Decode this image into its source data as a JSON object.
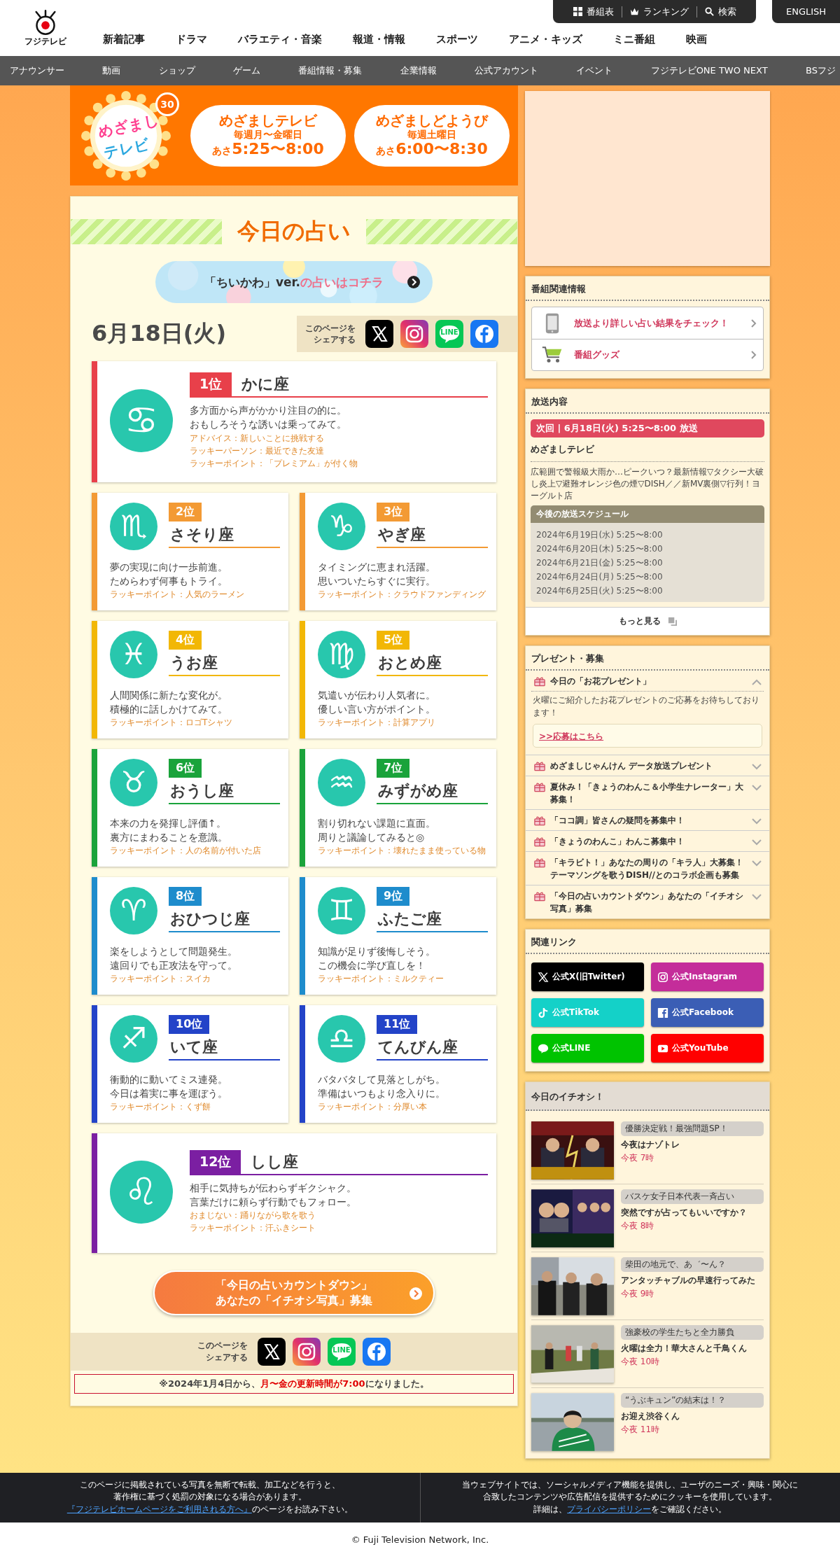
{
  "header": {
    "logo_text": "フジテレビ",
    "utility": [
      {
        "kind": "grid",
        "label": "番組表"
      },
      {
        "kind": "crown",
        "label": "ランキング"
      },
      {
        "kind": "search",
        "label": "検索"
      }
    ],
    "english": "ENGLISH",
    "nav": [
      "新着記事",
      "ドラマ",
      "バラエティ・音楽",
      "報道・情報",
      "スポーツ",
      "アニメ・キッズ",
      "ミニ番組",
      "映画"
    ],
    "subnav": [
      "アナウンサー",
      "動画",
      "ショップ",
      "ゲーム",
      "番組情報・募集",
      "企業情報",
      "公式アカウント",
      "イベント",
      "フジテレビONE TWO NEXT",
      "BSフジ"
    ]
  },
  "banner": {
    "logo_top": "めざまし",
    "logo_bottom": "テレビ",
    "badge": "30",
    "programs": [
      {
        "title": "めざましテレビ",
        "days": "毎週月〜金曜日",
        "time_prefix": "あさ",
        "time": "5:25〜8:00"
      },
      {
        "title": "めざましどようび",
        "days": "毎週土曜日",
        "time_prefix": "あさ",
        "time": "6:00〜8:30"
      }
    ]
  },
  "fortune": {
    "title": "今日の占い",
    "promo": {
      "lead": "「ちいかわ」ver.",
      "rest": "の占いはコチラ"
    },
    "date": "6月18日(火)",
    "share": {
      "label": [
        "このページを",
        "シェアする"
      ],
      "icons": [
        {
          "kind": "x"
        },
        {
          "kind": "instagram"
        },
        {
          "kind": "line",
          "text": "LINE"
        },
        {
          "kind": "facebook"
        }
      ]
    },
    "signs": [
      {
        "kind": "wide",
        "rank": "1位",
        "name": "かに座",
        "symbol": "♋",
        "color": "#e8404a",
        "lines": [
          "多方面から声がかかり注目の的に。",
          "おもしろそうな誘いは乗ってみて。"
        ],
        "extras": [
          "アドバイス：新しいことに挑戦する",
          "ラッキーパーソン：最近できた友達",
          "ラッキーポイント：「プレミアム」が付く物"
        ]
      },
      {
        "kind": "half",
        "rank": "2位",
        "name": "さそり座",
        "symbol": "♏",
        "color": "#f39a34",
        "lines": [
          "夢の実現に向け一歩前進。",
          "ためらわず何事もトライ。"
        ],
        "extras": [
          "ラッキーポイント：人気のラーメン"
        ]
      },
      {
        "kind": "half",
        "rank": "3位",
        "name": "やぎ座",
        "symbol": "♑",
        "color": "#f39a34",
        "lines": [
          "タイミングに恵まれ活躍。",
          "思いついたらすぐに実行。"
        ],
        "extras": [
          "ラッキーポイント：クラウドファンディング"
        ]
      },
      {
        "kind": "half",
        "rank": "4位",
        "name": "うお座",
        "symbol": "♓",
        "color": "#f2b705",
        "lines": [
          "人間関係に新たな変化が。",
          "積極的に話しかけてみて。"
        ],
        "extras": [
          "ラッキーポイント：ロゴTシャツ"
        ]
      },
      {
        "kind": "half",
        "rank": "5位",
        "name": "おとめ座",
        "symbol": "♍",
        "color": "#f2b705",
        "lines": [
          "気遣いが伝わり人気者に。",
          "優しい言い方がポイント。"
        ],
        "extras": [
          "ラッキーポイント：計算アプリ"
        ]
      },
      {
        "kind": "half",
        "rank": "6位",
        "name": "おうし座",
        "symbol": "♉",
        "color": "#1aa33b",
        "lines": [
          "本来の力を発揮し評価↑。",
          "裏方にまわることを意識。"
        ],
        "extras": [
          "ラッキーポイント：人の名前が付いた店"
        ]
      },
      {
        "kind": "half",
        "rank": "7位",
        "name": "みずがめ座",
        "symbol": "♒",
        "color": "#1aa33b",
        "lines": [
          "割り切れない課題に直面。",
          "周りと議論してみると◎"
        ],
        "extras": [
          "ラッキーポイント：壊れたまま使っている物"
        ]
      },
      {
        "kind": "half",
        "rank": "8位",
        "name": "おひつじ座",
        "symbol": "♈",
        "color": "#1e8ccc",
        "lines": [
          "楽をしようとして問題発生。",
          "遠回りでも正攻法を守って。"
        ],
        "extras": [
          "ラッキーポイント：スイカ"
        ]
      },
      {
        "kind": "half",
        "rank": "9位",
        "name": "ふたご座",
        "symbol": "♊",
        "color": "#1e8ccc",
        "lines": [
          "知識が足りず後悔しそう。",
          "この機会に学び直しを！"
        ],
        "extras": [
          "ラッキーポイント：ミルクティー"
        ]
      },
      {
        "kind": "half",
        "rank": "10位",
        "name": "いて座",
        "symbol": "♐",
        "color": "#2343c8",
        "lines": [
          "衝動的に動いてミス連発。",
          "今日は着実に事を運ぼう。"
        ],
        "extras": [
          "ラッキーポイント：くず餅"
        ]
      },
      {
        "kind": "half",
        "rank": "11位",
        "name": "てんびん座",
        "symbol": "♎",
        "color": "#2343c8",
        "lines": [
          "バタバタして見落としがち。",
          "準備はいつもより念入りに。"
        ],
        "extras": [
          "ラッキーポイント：分厚い本"
        ]
      },
      {
        "kind": "wide",
        "rank": "12位",
        "name": "しし座",
        "symbol": "♌",
        "color": "#7b1fa2",
        "lines": [
          "相手に気持ちが伝わらずギクシャク。",
          "言葉だけに頼らず行動でもフォロー。"
        ],
        "extras": [
          "おまじない：踊りながら歌を歌う",
          "ラッキーポイント：汗ふきシート"
        ]
      }
    ],
    "countdown": [
      "「今日の占いカウントダウン」",
      "あなたの「イチオシ写真」募集"
    ],
    "share_bottom": {
      "label": [
        "このページを",
        "シェアする"
      ],
      "icons": [
        {
          "kind": "x"
        },
        {
          "kind": "instagram"
        },
        {
          "kind": "line",
          "text": "LINE"
        },
        {
          "kind": "facebook"
        }
      ]
    },
    "notice": [
      {
        "text": "※2024年1月4日から、",
        "highlight": false
      },
      {
        "text": "月〜金の更新時間が7:00",
        "highlight": true
      },
      {
        "text": "になりました。",
        "highlight": false
      }
    ]
  },
  "sidebar": {
    "related": {
      "title": "番組関連情報",
      "links": [
        {
          "kind": "phone",
          "label": "放送より詳しい占い結果をチェック！"
        },
        {
          "kind": "cart",
          "label": "番組グッズ"
        }
      ]
    },
    "broadcast": {
      "title": "放送内容",
      "next": "次回 | 6月18日(火) 5:25〜8:00 放送",
      "program": "めざましテレビ",
      "description": "広範囲で警報級大雨か…ピークいつ？最新情報▽タクシー大破し炎上▽避難オレンジ色の煙▽DISH／／新MV裏側▽行列！ヨーグルト店",
      "schedule_title": "今後の放送スケジュール",
      "schedule": [
        "2024年6月19日(水) 5:25〜8:00",
        "2024年6月20日(木) 5:25〜8:00",
        "2024年6月21日(金) 5:25〜8:00",
        "2024年6月24日(月) 5:25〜8:00",
        "2024年6月25日(火) 5:25〜8:00"
      ],
      "more": "もっと見る"
    },
    "presents": {
      "title": "プレゼント・募集",
      "items": [
        {
          "label": "今日の「お花プレゼント」",
          "expanded": true,
          "body": "火曜にご紹介したお花プレゼントのご応募をお待ちしております！",
          "link": ">>応募はこちら"
        },
        {
          "label": "めざましじゃんけん データ放送プレゼント",
          "expanded": false
        },
        {
          "label": "夏休み！「きょうのわんこ＆小学生ナレーター」大募集！",
          "expanded": false
        },
        {
          "label": "「ココ調」皆さんの疑問を募集中！",
          "expanded": false
        },
        {
          "label": "「きょうのわんこ」わんこ募集中！",
          "expanded": false
        },
        {
          "label": "「キラビト！」あなたの周りの「キラ人」大募集！テーマソングを歌うDISH//とのコラボ企画も募集",
          "expanded": false
        },
        {
          "label": "「今日の占いカウントダウン」あなたの「イチオシ写真」募集",
          "expanded": false
        }
      ]
    },
    "links": {
      "title": "関連リンク",
      "buttons": [
        {
          "kind": "x",
          "label": "公式X(旧Twitter)",
          "color": "#000000"
        },
        {
          "kind": "instagram",
          "label": "公式Instagram",
          "color": "#c42d9a"
        },
        {
          "kind": "tiktok",
          "label": "公式TikTok",
          "color": "#14d1c8"
        },
        {
          "kind": "facebook",
          "label": "公式Facebook",
          "color": "#3b5eb5"
        },
        {
          "kind": "line",
          "label": "公式LINE",
          "color": "#00c300"
        },
        {
          "kind": "youtube",
          "label": "公式YouTube",
          "color": "#ff0000"
        }
      ]
    },
    "picks": {
      "title": "今日のイチオシ！",
      "items": [
        {
          "kind": "picture",
          "tag": "優勝決定戦！最強問題SP！",
          "title": "今夜はナゾトレ",
          "time": "今夜 7時"
        },
        {
          "kind": "picture",
          "tag": "バスケ女子日本代表一斉占い",
          "title": "突然ですが占ってもいいですか？",
          "time": "今夜 8時"
        },
        {
          "kind": "picture",
          "tag": "柴田の地元で、あ゛〜ん？",
          "title": "アンタッチャブルの早速行ってみた",
          "time": "今夜 9時"
        },
        {
          "kind": "picture",
          "tag": "強豪校の学生たちと全力勝負",
          "title": "火曜は全力！華大さんと千鳥くん",
          "time": "今夜 10時"
        },
        {
          "kind": "picture",
          "tag": "“うぶキュン”の結末は！？",
          "title": "お迎え渋谷くん",
          "time": "今夜 11時"
        }
      ]
    }
  },
  "footer": {
    "left": [
      [
        {
          "text": "このページに掲載されている写真を無断で転載、加工などを行うと、",
          "link": false
        }
      ],
      [
        {
          "text": "著作権に基づく処罰の対象になる場合があります。",
          "link": false
        }
      ],
      [
        {
          "text": "『フジテレビホームページをご利用される方へ』",
          "link": true
        },
        {
          "text": "のページをお読み下さい。",
          "link": false
        }
      ]
    ],
    "right": [
      [
        {
          "text": "当ウェブサイトでは、ソーシャルメディア機能を提供し、ユーザのニーズ・興味・関心に",
          "link": false
        }
      ],
      [
        {
          "text": "合致したコンテンツや広告配信を提供するためにクッキーを使用しています。",
          "link": false
        }
      ],
      [
        {
          "text": "詳細は、",
          "link": false
        },
        {
          "text": "プライバシーポリシー",
          "link": true
        },
        {
          "text": "をご確認ください。",
          "link": false
        }
      ]
    ],
    "copyright": "© Fuji Television Network, Inc."
  }
}
